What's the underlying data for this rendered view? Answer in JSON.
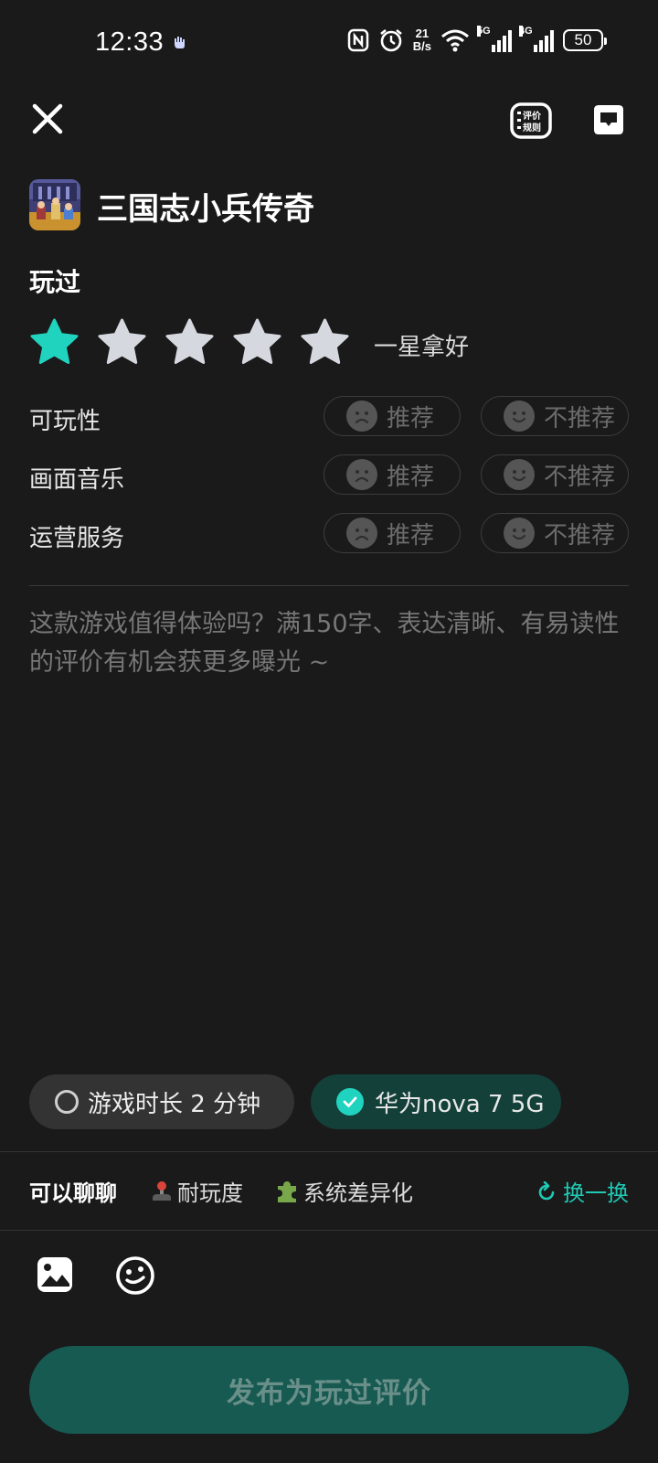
{
  "status_bar": {
    "time": "12:33",
    "net_speed_value": "21",
    "net_speed_unit": "B/s",
    "sim1_type": "5G",
    "sim2_type": "4G",
    "battery": "50"
  },
  "header": {
    "rules_label_line1": "评价",
    "rules_label_line2": "规则"
  },
  "game": {
    "title": "三国志小兵传奇"
  },
  "review": {
    "status_label": "玩过",
    "rating": 1,
    "rating_max": 5,
    "rating_text": "一星拿好",
    "categories": [
      {
        "label": "可玩性",
        "recommend": "推荐",
        "not_recommend": "不推荐"
      },
      {
        "label": "画面音乐",
        "recommend": "推荐",
        "not_recommend": "不推荐"
      },
      {
        "label": "运营服务",
        "recommend": "推荐",
        "not_recommend": "不推荐"
      }
    ],
    "placeholder": "这款游戏值得体验吗？满150字、表达清晰、有易读性的评价有机会获更多曝光 ~"
  },
  "chips": {
    "play_time": "游戏时长 2 分钟",
    "device": "华为nova 7 5G"
  },
  "topics": {
    "lead": "可以聊聊",
    "items": [
      {
        "label": "耐玩度",
        "icon": "joystick-icon"
      },
      {
        "label": "系统差异化",
        "icon": "puzzle-icon"
      }
    ],
    "swap": "换一换"
  },
  "actions": {
    "publish": "发布为玩过评价"
  },
  "colors": {
    "accent": "#20d3bf",
    "background": "#1a1a1a",
    "star_inactive": "#d5d9df",
    "publish_bg": "#165a52"
  }
}
